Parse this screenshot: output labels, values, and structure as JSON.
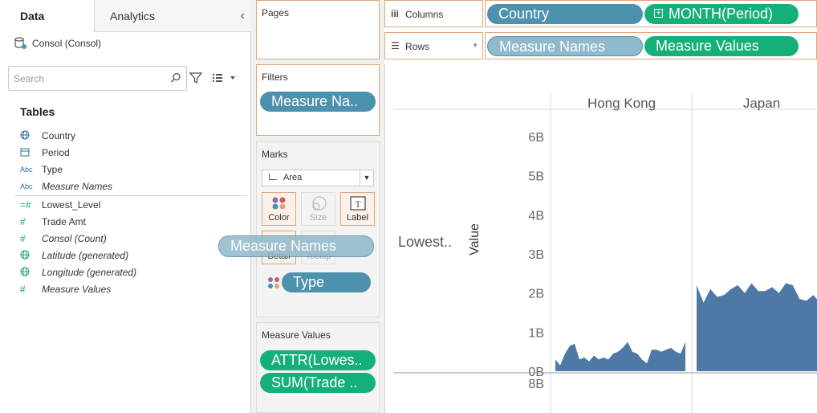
{
  "left_pane": {
    "tabs": {
      "data": "Data",
      "analytics": "Analytics"
    },
    "datasource": "Consol (Consol)",
    "search_placeholder": "Search",
    "tables_title": "Tables",
    "dimensions": [
      {
        "icon": "globe-icon",
        "label": "Country"
      },
      {
        "icon": "calendar-icon",
        "label": "Period"
      },
      {
        "icon": "abc-icon",
        "label": "Type"
      },
      {
        "icon": "abc-icon",
        "label": "Measure Names"
      }
    ],
    "measures": [
      {
        "icon": "hash-icon",
        "label": "Lowest_Level"
      },
      {
        "icon": "hash-icon",
        "label": "Trade Amt"
      },
      {
        "icon": "hash-icon",
        "label": "Consol (Count)"
      },
      {
        "icon": "globe-icon",
        "label": "Latitude (generated)"
      },
      {
        "icon": "globe-icon",
        "label": "Longitude (generated)"
      },
      {
        "icon": "hash-icon",
        "label": "Measure Values"
      }
    ]
  },
  "cards": {
    "pages": "Pages",
    "filters": "Filters",
    "filter_pill": "Measure Na..",
    "marks": "Marks",
    "mark_type": "Area",
    "mark_buttons": {
      "color": "Color",
      "size": "Size",
      "label": "Label",
      "detail": "Detail",
      "tooltip": "Tooltip"
    },
    "drag_pill": "Measure Names",
    "type_pill": "Type",
    "measure_values": "Measure Values",
    "mv_pills": [
      "ATTR(Lowes..",
      "SUM(Trade .."
    ]
  },
  "shelves": {
    "columns_label": "Columns",
    "rows_label": "Rows",
    "columns_pills": [
      "Country",
      "MONTH(Period)"
    ],
    "rows_pills": [
      "Measure Names",
      "Measure Values"
    ]
  },
  "colors": {
    "accent_orange": "#e0a477",
    "pill_blue": "#4c91ad",
    "pill_green": "#15b07a",
    "area_fill": "#4e79a7"
  },
  "chart_data": {
    "type": "area",
    "column_headers": [
      "Hong Kong",
      "Japan"
    ],
    "row_header": "Lowest..",
    "ylabel": "Value",
    "y_ticks": [
      "6B",
      "5B",
      "4B",
      "3B",
      "2B",
      "1B",
      "0B"
    ],
    "next_pane_first_tick": "8B",
    "ylim": [
      0,
      6.6
    ],
    "series": [
      {
        "panel": "Hong Kong",
        "values": [
          0.3,
          0.15,
          0.45,
          0.65,
          0.7,
          0.3,
          0.35,
          0.25,
          0.4,
          0.3,
          0.35,
          0.3,
          0.45,
          0.5,
          0.6,
          0.75,
          0.5,
          0.45,
          0.3,
          0.2,
          0.55,
          0.55,
          0.5,
          0.55,
          0.6,
          0.5,
          0.45,
          0.75
        ]
      },
      {
        "panel": "Japan",
        "values": [
          2.2,
          1.75,
          2.1,
          1.9,
          1.95,
          2.1,
          2.2,
          2.0,
          2.25,
          2.05,
          2.05,
          2.15,
          2.0,
          2.25,
          2.2,
          1.85,
          1.8,
          1.95,
          1.75,
          1.95,
          2.05
        ]
      }
    ]
  }
}
